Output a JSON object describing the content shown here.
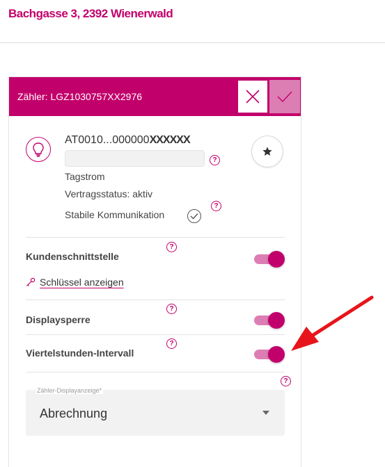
{
  "header": {
    "address": "Bachgasse 3, 2392 Wienerwald"
  },
  "card": {
    "title_prefix": "Zähler: ",
    "title_meter": "LGZ1030757XX2976",
    "cancel_icon": "close-icon",
    "confirm_icon": "check-icon"
  },
  "meter": {
    "icon": "lightbulb-icon",
    "id_visible": "AT0010...000000",
    "id_masked": "XXXXXX",
    "name_value": "",
    "tariff": "Tagstrom",
    "contract_status": "Vertragsstatus: aktiv",
    "communication": "Stabile Kommunikation",
    "favorite_icon": "star-icon"
  },
  "settings": [
    {
      "label": "Kundenschnittstelle",
      "enabled": true
    },
    {
      "label": "Displaysperre",
      "enabled": true
    },
    {
      "label": "Viertelstunden-Intervall",
      "enabled": true
    }
  ],
  "key_link": {
    "icon": "key-icon",
    "label": "Schlüssel anzeigen"
  },
  "display_select": {
    "legend": "Zähler-Displayanzeige*",
    "value": "Abrechnung"
  },
  "help_symbol": "?",
  "colors": {
    "brand": "#c2006b",
    "brand_light": "#dc7eb3",
    "annotation_arrow": "#e8141b"
  }
}
